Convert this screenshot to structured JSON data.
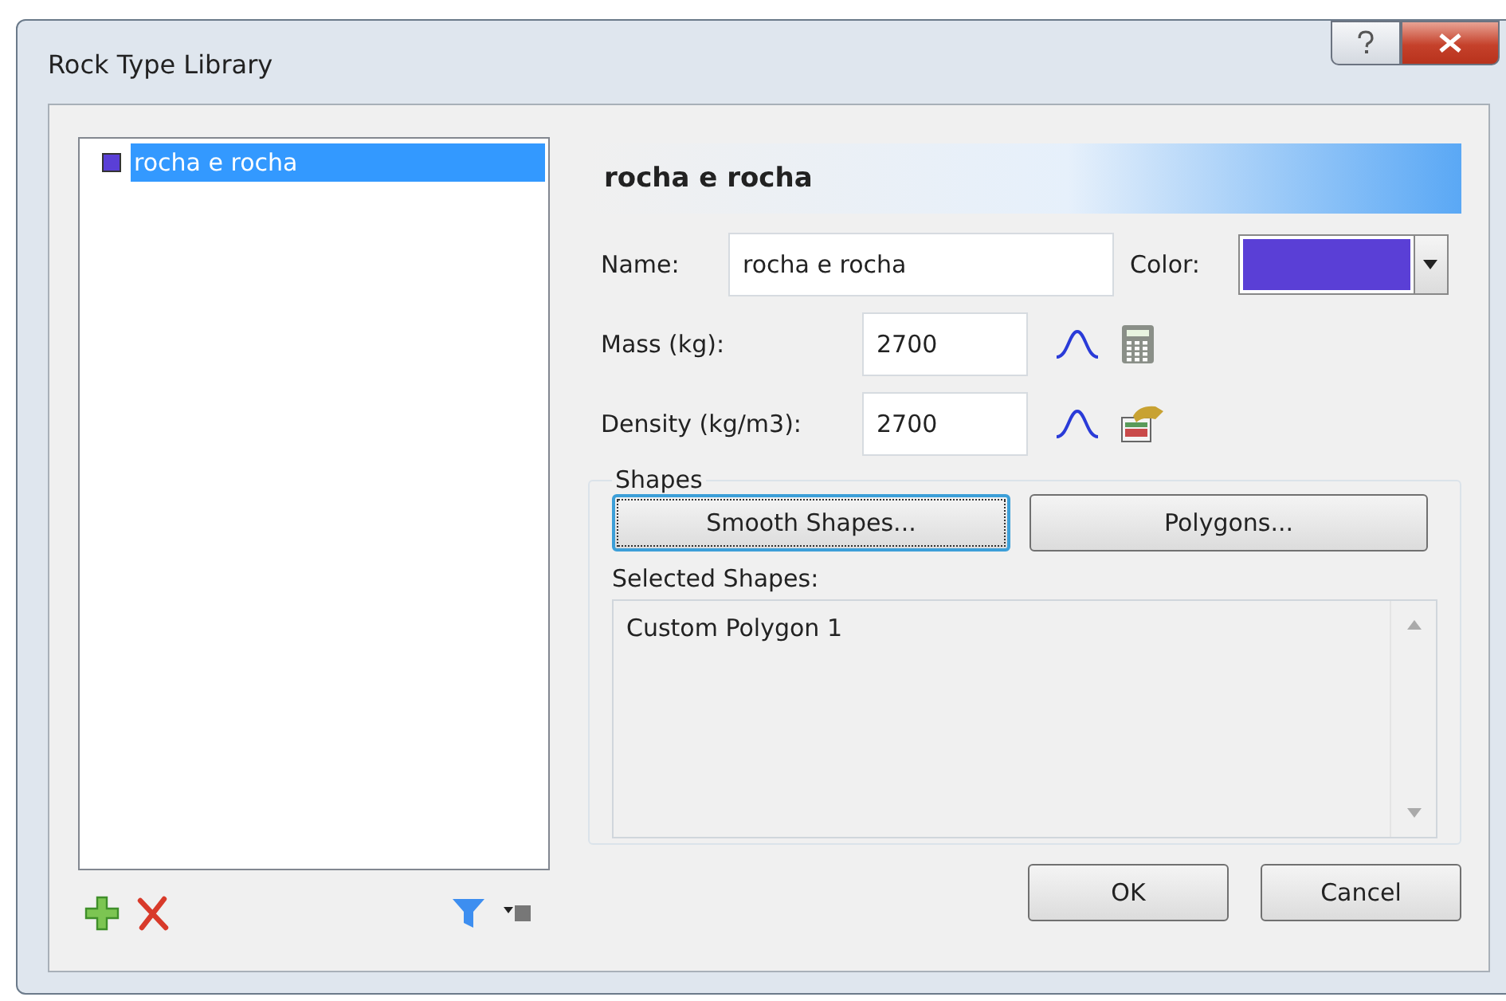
{
  "window": {
    "title": "Rock Type Library"
  },
  "library": {
    "items": [
      {
        "name": "rocha e rocha",
        "color": "#5a3fd6",
        "selected": true
      }
    ]
  },
  "details": {
    "header": "rocha e rocha",
    "name_label": "Name:",
    "name_value": "rocha e rocha",
    "color_label": "Color:",
    "color": "#5a3fd6",
    "mass_label": "Mass (kg):",
    "mass_value": "2700",
    "density_label": "Density (kg/m3):",
    "density_value": "2700",
    "shapes": {
      "legend": "Shapes",
      "buttons": [
        {
          "label": "Smooth Shapes...",
          "focused": true
        },
        {
          "label": "Polygons...",
          "focused": false
        }
      ],
      "selected_label": "Selected Shapes:",
      "selected_items": [
        "Custom Polygon 1"
      ]
    }
  },
  "buttons": [
    "OK",
    "Cancel"
  ]
}
